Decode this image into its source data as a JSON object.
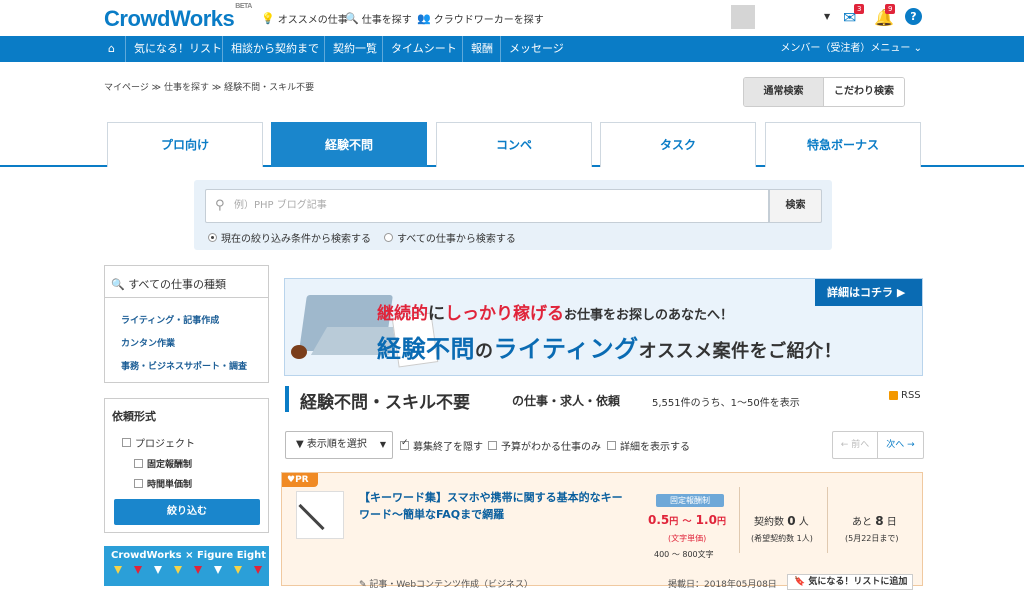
{
  "header": {
    "logo": "CrowdWorks",
    "logo_beta": "BETA",
    "links": [
      "オススメの仕事",
      "仕事を探す",
      "クラウドワーカーを探す"
    ],
    "mail_badge": "3",
    "bell_badge": "9",
    "help": "?"
  },
  "nav": {
    "items": [
      "気になる！リスト",
      "相談から契約まで",
      "契約一覧",
      "タイムシート",
      "報酬",
      "メッセージ"
    ],
    "member_menu": "メンバー（受注者）メニュー"
  },
  "breadcrumb": "マイページ ≫ 仕事を探す ≫ 経験不問・スキル不要",
  "search_mode": {
    "normal": "通常検索",
    "advanced": "こだわり検索"
  },
  "tabs": [
    "プロ向け",
    "経験不問",
    "コンペ",
    "タスク",
    "特急ボーナス"
  ],
  "search": {
    "placeholder": "例）PHP ブログ記事",
    "button": "検索",
    "radio1": "現在の絞り込み条件から検索する",
    "radio2": "すべての仕事から検索する"
  },
  "sidebar": {
    "categories_title": "すべての仕事の種類",
    "categories": [
      "ライティング・記事作成",
      "カンタン作業",
      "事務・ビジネスサポート・調査"
    ],
    "request_title": "依頼形式",
    "project": "プロジェクト",
    "fixed": "固定報酬制",
    "hourly": "時間単価制",
    "narrow_button": "絞り込む",
    "banner_text": "CrowdWorks × Figure Eight"
  },
  "banner": {
    "button": "詳細はコチラ ▶",
    "line1_a": "継続的",
    "line1_b": "に",
    "line1_c": "しっかり稼げる",
    "line1_d": "お仕事をお探しのあなたへ！",
    "line2_a": "経験不問",
    "line2_b": "の",
    "line2_c": "ライティング",
    "line2_d": "オススメ案件をご紹介！"
  },
  "listing": {
    "title": "経験不問・スキル不要",
    "subtitle": "の仕事・求人・依頼",
    "count": "5,551件のうち、1～50件を表示",
    "rss": "RSS",
    "sort": "▼ 表示順を選択",
    "filter1": "募集終了を隠す",
    "filter2": "予算がわかる仕事のみ",
    "filter3": "詳細を表示する",
    "prev": "← 前へ",
    "next": "次へ →"
  },
  "job": {
    "pr": "PR",
    "title": "【キーワード集】スマホや携帯に関する基本的なキーワード～簡単なFAQまで網羅",
    "type": "固定報酬制",
    "price_min": "0.5",
    "price_max": "1.0",
    "price_unit": "円",
    "price_sep": "～",
    "price_type": "(文字単価)",
    "chars": "400 ～ 800文字",
    "contracts_label": "契約数",
    "contracts": "0",
    "contracts_unit": "人",
    "contracts_sub": "(希望契約数 1人)",
    "days_label": "あと",
    "days": "8",
    "days_unit": "日",
    "deadline": "(5月22日まで)",
    "category": "記事・Webコンテンツ作成（ビジネス）",
    "updated": "掲載日：2018年05月08日",
    "fav_button": "気になる！リストに追加"
  }
}
